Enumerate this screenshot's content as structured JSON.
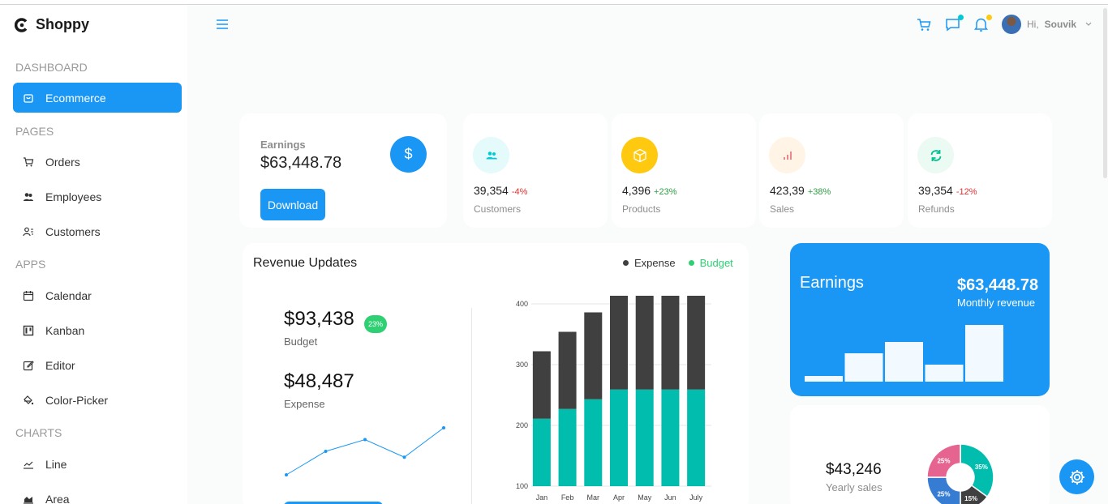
{
  "app": {
    "name": "Shoppy"
  },
  "sidebar": {
    "sections": [
      "DASHBOARD",
      "PAGES",
      "APPS",
      "CHARTS"
    ],
    "items": [
      {
        "label": "Ecommerce",
        "icon": "bag-icon"
      },
      {
        "label": "Orders",
        "icon": "cart-icon"
      },
      {
        "label": "Employees",
        "icon": "people-icon"
      },
      {
        "label": "Customers",
        "icon": "customer-icon"
      },
      {
        "label": "Calendar",
        "icon": "calendar-icon"
      },
      {
        "label": "Kanban",
        "icon": "kanban-icon"
      },
      {
        "label": "Editor",
        "icon": "edit-icon"
      },
      {
        "label": "Color-Picker",
        "icon": "color-picker-icon"
      },
      {
        "label": "Line",
        "icon": "line-chart-icon"
      },
      {
        "label": "Area",
        "icon": "area-chart-icon"
      }
    ]
  },
  "topbar": {
    "greeting": "Hi,",
    "username": "Souvik",
    "chat_dot_color": "#03c9d7",
    "bell_dot_color": "#fec90f"
  },
  "earnings_card": {
    "title": "Earnings",
    "value": "$63,448.78",
    "icon_glyph": "$",
    "button": "Download"
  },
  "stats": [
    {
      "value": "39,354",
      "pct": "-4%",
      "pct_color": "#e03131",
      "label": "Customers",
      "icon_bg": "#e5fafb",
      "icon_color": "#03c9d7"
    },
    {
      "value": "4,396",
      "pct": "+23%",
      "pct_color": "#2f9e44",
      "label": "Products",
      "icon_bg": "#fec90f",
      "icon_color": "#ffffff"
    },
    {
      "value": "423,39",
      "pct": "+38%",
      "pct_color": "#2f9e44",
      "label": "Sales",
      "icon_bg": "#fff4e5",
      "icon_color": "#e46a76"
    },
    {
      "value": "39,354",
      "pct": "-12%",
      "pct_color": "#e03131",
      "label": "Refunds",
      "icon_bg": "#ebfaf2",
      "icon_color": "#00c292"
    }
  ],
  "revenue": {
    "title": "Revenue Updates",
    "legend_expense": "Expense",
    "legend_budget": "Budget",
    "budget_value": "$93,438",
    "budget_badge": "23%",
    "budget_label": "Budget",
    "expense_value": "$48,487",
    "expense_label": "Expense"
  },
  "chart_data": [
    {
      "type": "bar",
      "stacked": true,
      "categories": [
        "Jan",
        "Feb",
        "Mar",
        "Apr",
        "May",
        "Jun",
        "July"
      ],
      "series": [
        {
          "name": "Budget",
          "color": "#00bdae",
          "values": [
            111,
            127,
            143,
            159,
            159,
            159,
            159
          ]
        },
        {
          "name": "Expense",
          "color": "#404041",
          "values": [
            111,
            127,
            143,
            159,
            159,
            159,
            159
          ]
        }
      ],
      "yticks": [
        100,
        200,
        300,
        400
      ],
      "ylim": [
        100,
        400
      ],
      "grid": true
    },
    {
      "type": "line",
      "values": [
        2,
        6,
        8,
        5,
        10
      ],
      "color": "#1a97f5"
    },
    {
      "type": "bar",
      "values": [
        1,
        5,
        7,
        3,
        10
      ],
      "color": "#ffffff"
    },
    {
      "type": "pie",
      "slices": [
        {
          "label": "35%",
          "value": 35,
          "color": "#00bdae"
        },
        {
          "label": "15%",
          "value": 15,
          "color": "#357cd2"
        },
        {
          "label": "25%",
          "value": 25,
          "color": "#357cd2"
        },
        {
          "label": "25%",
          "value": 25,
          "color": "#e56590"
        }
      ]
    }
  ],
  "blue_earnings": {
    "title": "Earnings",
    "value": "$63,448.78",
    "sub": "Monthly revenue"
  },
  "yearly": {
    "value": "$43,246",
    "label": "Yearly sales"
  }
}
